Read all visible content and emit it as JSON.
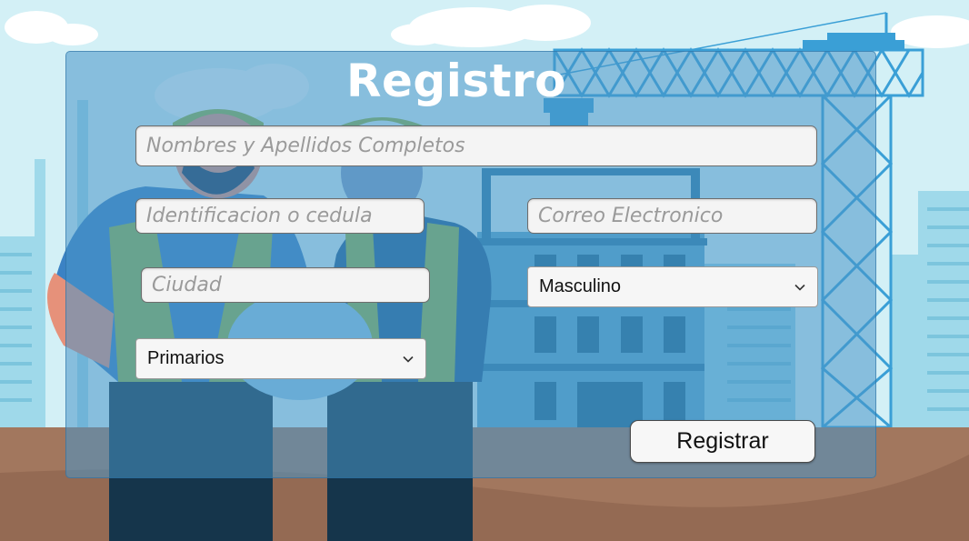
{
  "form": {
    "title": "Registro",
    "fields": {
      "full_name": {
        "placeholder": "Nombres y Apellidos Completos",
        "value": ""
      },
      "id_number": {
        "placeholder": "Identificacion o cedula",
        "value": ""
      },
      "email": {
        "placeholder": "Correo Electronico",
        "value": ""
      },
      "city": {
        "placeholder": "Ciudad",
        "value": ""
      }
    },
    "gender_select": {
      "selected": "Masculino"
    },
    "education_select": {
      "selected": "Primarios"
    },
    "submit_label": "Registrar"
  },
  "colors": {
    "sky": "#cfeef5",
    "panel": "#4996c8",
    "ground": "#a2775e",
    "crane": "#3a9fd6"
  }
}
